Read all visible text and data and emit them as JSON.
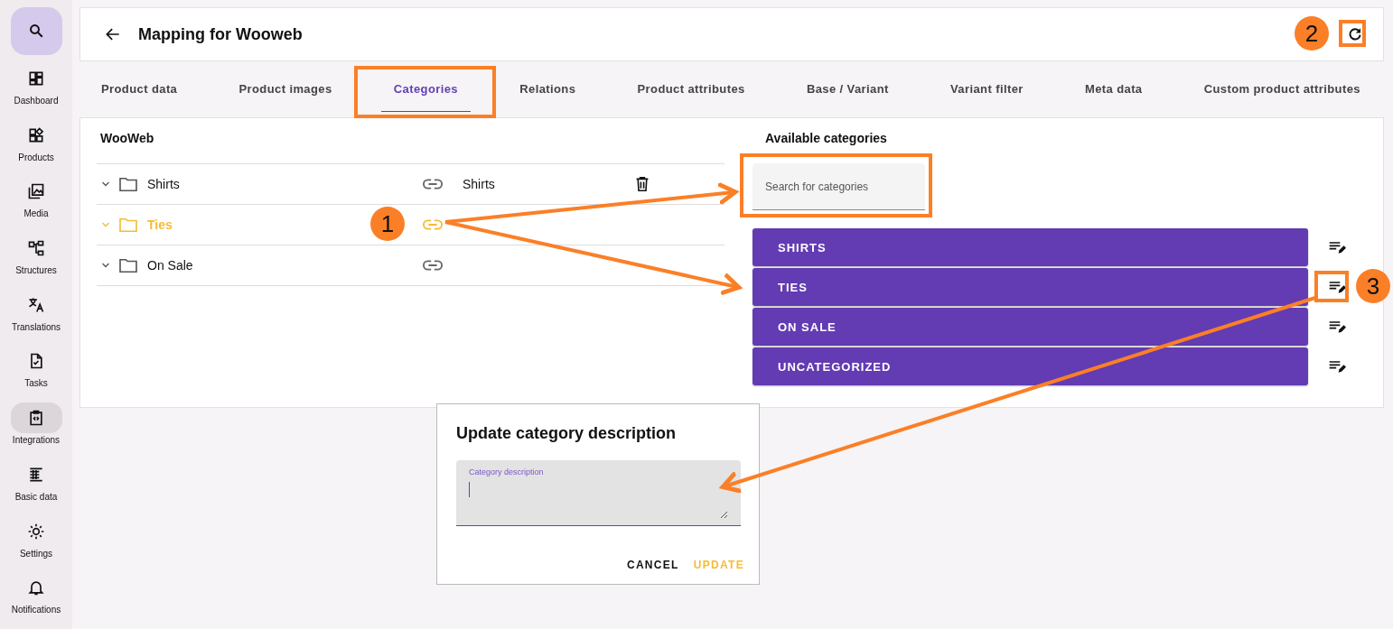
{
  "sidebar": {
    "items": [
      {
        "label": "Dashboard",
        "selected": false
      },
      {
        "label": "Products",
        "selected": false
      },
      {
        "label": "Media",
        "selected": false
      },
      {
        "label": "Structures",
        "selected": false
      },
      {
        "label": "Translations",
        "selected": false
      },
      {
        "label": "Tasks",
        "selected": false
      },
      {
        "label": "Integrations",
        "selected": true
      },
      {
        "label": "Basic data",
        "selected": false
      },
      {
        "label": "Settings",
        "selected": false
      },
      {
        "label": "Notifications",
        "selected": false
      }
    ]
  },
  "header": {
    "title": "Mapping for Wooweb"
  },
  "tabs": [
    {
      "label": "Product data",
      "selected": false
    },
    {
      "label": "Product images",
      "selected": false
    },
    {
      "label": "Categories",
      "selected": true
    },
    {
      "label": "Relations",
      "selected": false
    },
    {
      "label": "Product attributes",
      "selected": false
    },
    {
      "label": "Base / Variant",
      "selected": false
    },
    {
      "label": "Variant filter",
      "selected": false
    },
    {
      "label": "Meta data",
      "selected": false
    },
    {
      "label": "Custom product attributes",
      "selected": false
    }
  ],
  "source": {
    "title": "WooWeb",
    "rows": [
      {
        "name": "Shirts",
        "selected": false,
        "mapped": "Shirts"
      },
      {
        "name": "Ties",
        "selected": true
      },
      {
        "name": "On Sale",
        "selected": false
      }
    ]
  },
  "available": {
    "title": "Available categories",
    "search": {
      "placeholder": "Search for categories"
    },
    "categories": [
      "SHIRTS",
      "TIES",
      "ON SALE",
      "UNCATEGORIZED"
    ]
  },
  "dialog": {
    "title": "Update category description",
    "field": {
      "label": "Category description"
    },
    "buttons": [
      "CANCEL",
      "UPDATE"
    ]
  },
  "annotations": [
    "1",
    "2",
    "3"
  ]
}
